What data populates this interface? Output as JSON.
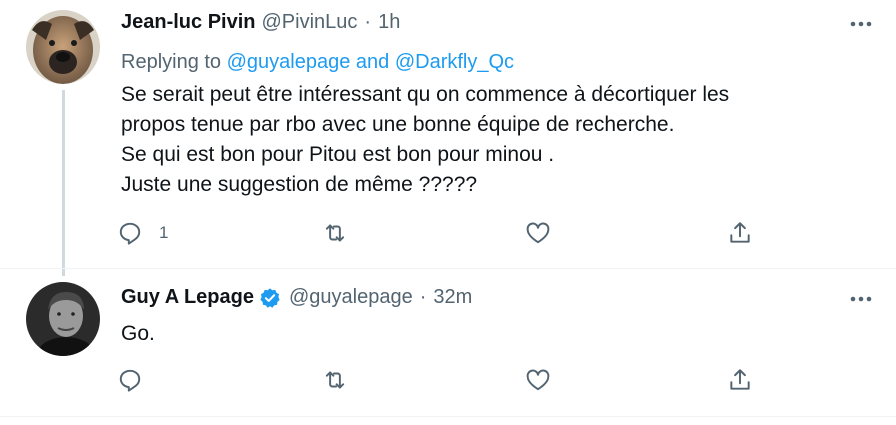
{
  "colors": {
    "accent": "#1d9bf0",
    "text": "#0f1419",
    "muted": "#536471",
    "line": "#cfd9de"
  },
  "tweets": [
    {
      "name": "Jean-luc Pivin",
      "handle": "@PivinLuc",
      "separator": "·",
      "time": "1h",
      "replying_prefix": "Replying to",
      "replying_users": "@guyalepage and @Darkfly_Qc",
      "text_lines": [
        "Se serait peut être intéressant qu on commence à décortiquer les",
        "propos tenue par rbo avec une bonne équipe de recherche.",
        "Se qui est bon pour Pitou est bon pour minou .",
        "Juste une suggestion de même ?????"
      ],
      "reply_count": "1",
      "icons": [
        "reply-icon",
        "retweet-icon",
        "like-icon",
        "share-icon",
        "more-icon"
      ]
    },
    {
      "name": "Guy A Lepage",
      "verified": true,
      "handle": "@guyalepage",
      "separator": "·",
      "time": "32m",
      "text": "Go.",
      "icons": [
        "reply-icon",
        "retweet-icon",
        "like-icon",
        "share-icon",
        "more-icon"
      ]
    }
  ]
}
